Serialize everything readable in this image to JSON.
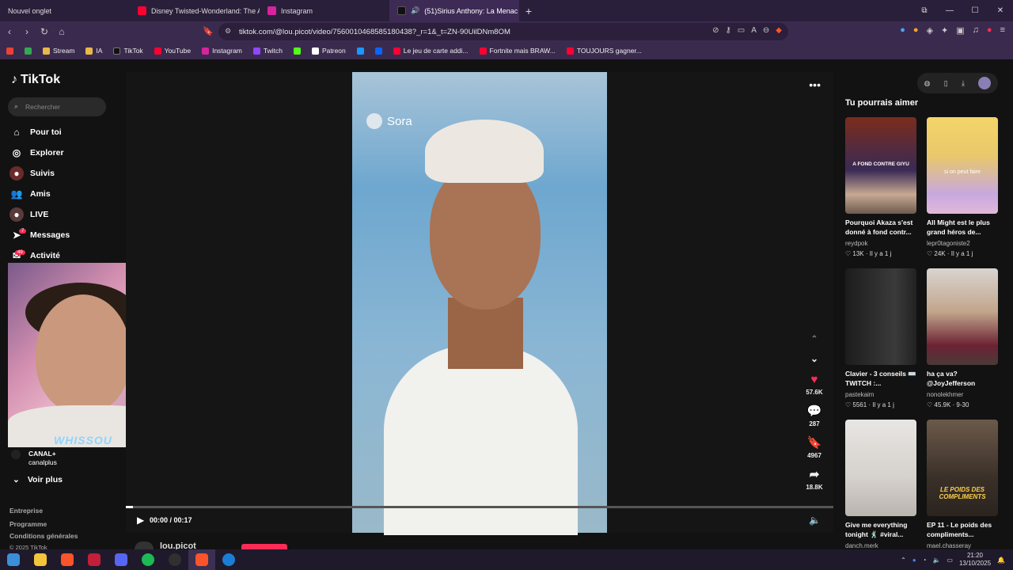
{
  "tabs": [
    {
      "label": "Nouvel onglet",
      "color": ""
    },
    {
      "label": "Disney Twisted-Wonderland: The Ani",
      "color": "#ff0033"
    },
    {
      "label": "Instagram",
      "color": "#d6249f"
    },
    {
      "label": "(51)Sirius Anthony: La Menac",
      "color": "#000000",
      "active": true
    }
  ],
  "url": "tiktok.com/@lou.picot/video/7560010468585180438?_r=1&_t=ZN-90UilDNm8OM",
  "bookmarks": [
    "Stream",
    "IA",
    "TikTok",
    "YouTube",
    "Instagram",
    "Twitch",
    "Patreon",
    "Le jeu de carte addi...",
    "Fortnite mais BRAW...",
    "TOUJOURS gagner..."
  ],
  "sidebar": {
    "logo": "TikTok",
    "search_placeholder": "Rechercher",
    "items": [
      "Pour toi",
      "Explorer",
      "Suivis",
      "Amis",
      "LIVE",
      "Messages",
      "Activité"
    ],
    "messages_badge": "7",
    "activity_badge": "49",
    "canal_name": "CANAL+",
    "canal_handle": "canalplus",
    "voir_plus": "Voir plus",
    "footer": [
      "Entreprise",
      "Programme",
      "Conditions générales",
      "© 2025 TikTok"
    ],
    "webcam_watermark": "WHISSOU"
  },
  "player": {
    "sora_label": "Sora",
    "likes": "57.6K",
    "comments": "287",
    "saves": "4967",
    "shares": "18.8K",
    "time": "00:00 / 00:17",
    "progress": 0.01,
    "author": "lou.picot"
  },
  "recs": {
    "title": "Tu pourrais aimer",
    "cards": [
      {
        "title": "Pourquoi Akaza s'est donné à fond contr...",
        "author": "reydpok",
        "likes": "13K",
        "age": "Il y a 1 j",
        "overlay": "A FOND CONTRE GIYU"
      },
      {
        "title": "All Might est le plus grand héros de...",
        "author": "lepr0tagoniste2",
        "likes": "24K",
        "age": "Il y a 1 j",
        "overlay": "si on peut faire"
      },
      {
        "title": "Clavier - 3 conseils ⌨️ TWITCH :...",
        "author": "pastekaim",
        "likes": "5561",
        "age": "Il y a 1 j",
        "overlay": ""
      },
      {
        "title": "ha ça va? @JoyJefferson",
        "author": "nonolekhmer",
        "likes": "45.9K",
        "age": "9-30",
        "overlay": ""
      },
      {
        "title": "Give me everything tonight 🕺 #viral...",
        "author": "danch.merk",
        "likes": "",
        "age": "",
        "overlay": ""
      },
      {
        "title": "EP 11 - Le poids des compliments...",
        "author": "mael.chasseray",
        "likes": "",
        "age": "",
        "overlay": "LE POIDS DES COMPLIMENTS"
      }
    ]
  },
  "taskbar": {
    "time": "21:20",
    "date": "13/10/2025"
  }
}
